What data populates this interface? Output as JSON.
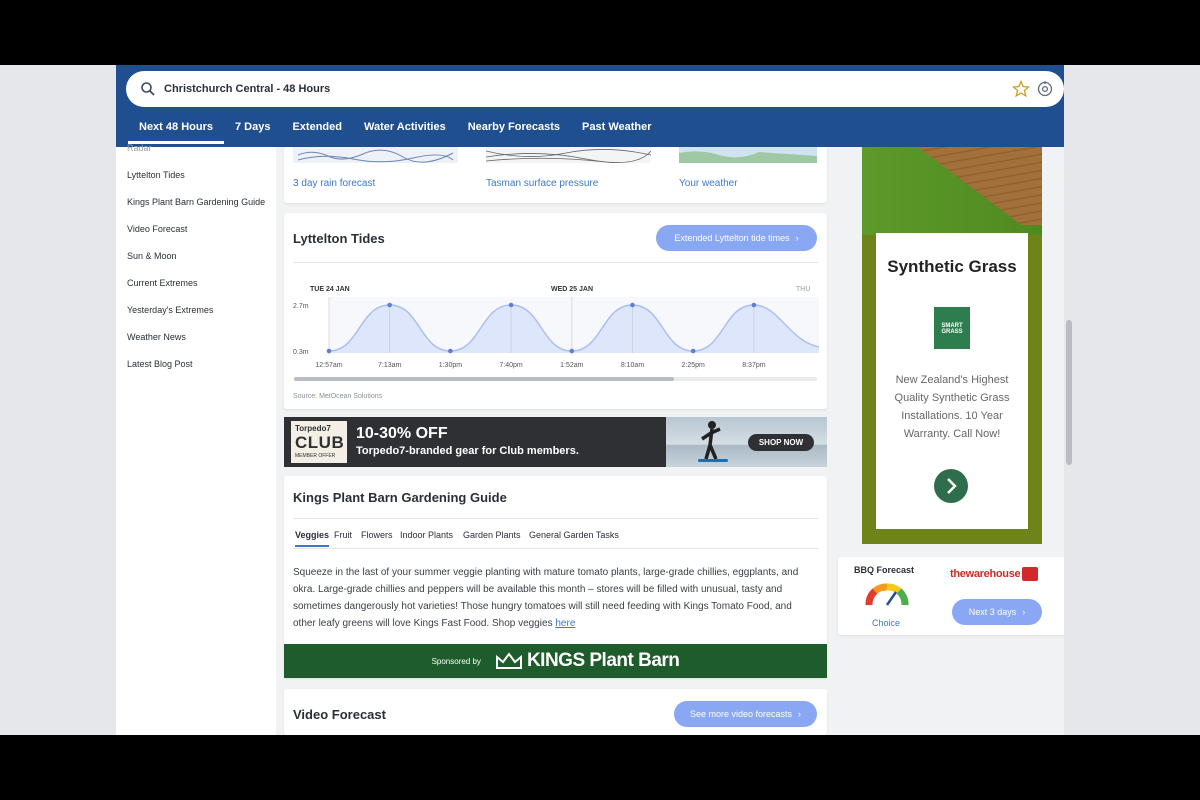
{
  "search": {
    "value": "Christchurch Central - 48 Hours"
  },
  "nav": [
    "Next 48 Hours",
    "7 Days",
    "Extended",
    "Water Activities",
    "Nearby Forecasts",
    "Past Weather"
  ],
  "sidebar": {
    "items": [
      "Radar",
      "Lyttelton Tides",
      "Kings Plant Barn Gardening Guide",
      "Video Forecast",
      "Sun & Moon",
      "Current Extremes",
      "Yesterday's Extremes",
      "Weather News",
      "Latest Blog Post"
    ]
  },
  "maps": {
    "links": [
      "3 day rain forecast",
      "Tasman surface pressure",
      "Your weather"
    ]
  },
  "tides": {
    "title": "Lyttelton Tides",
    "button": "Extended Lyttelton tide times",
    "days": [
      "TUE 24 JAN",
      "WED 25 JAN",
      "THU"
    ],
    "high_label": "2.7m",
    "low_label": "0.3m",
    "times": [
      "12:57am",
      "7:13am",
      "1:30pm",
      "7:40pm",
      "1:52am",
      "8:10am",
      "2:25pm",
      "8:37pm"
    ],
    "levels": [
      "low",
      "high",
      "low",
      "high",
      "low",
      "high",
      "low",
      "high"
    ],
    "source": "Source: MetOcean Solutions"
  },
  "promo": {
    "logo_top": "Torpedo7",
    "logo_main": "CLUB",
    "logo_sub": "MEMBER OFFER",
    "headline": "10-30% OFF",
    "subline": "Torpedo7-branded gear for Club members.",
    "button": "SHOP NOW"
  },
  "garden": {
    "title": "Kings Plant Barn Gardening Guide",
    "tabs": [
      "Veggies",
      "Fruit",
      "Flowers",
      "Indoor Plants",
      "Garden Plants",
      "General Garden Tasks"
    ],
    "body": "Squeeze in the last of your summer veggie planting with mature tomato plants, large-grade chillies, eggplants, and okra. Large-grade chillies and peppers will be available this month – stores will be filled with unusual, tasty and sometimes dangerously hot varieties! Those hungry tomatoes will still need feeding with Kings Tomato Food, and other leafy greens will love Kings Fast Food. Shop veggies",
    "link": "here",
    "sponsored_by": "Sponsored by",
    "sponsor": "KINGS Plant Barn"
  },
  "video": {
    "title": "Video Forecast",
    "button": "See more video forecasts"
  },
  "ad": {
    "title": "Synthetic Grass",
    "logo": "SMART GRASS",
    "body": "New Zealand's Highest Quality Synthetic Grass Installations. 10 Year Warranty. Call Now!"
  },
  "bbq": {
    "title": "BBQ Forecast",
    "rating": "Choice",
    "brand": "thewarehouse",
    "button": "Next 3 days"
  },
  "colors": {
    "header": "#1f4f8f",
    "accent": "#8aa7f3",
    "link": "#3f78c9",
    "sponsor": "#1e5c2b"
  }
}
